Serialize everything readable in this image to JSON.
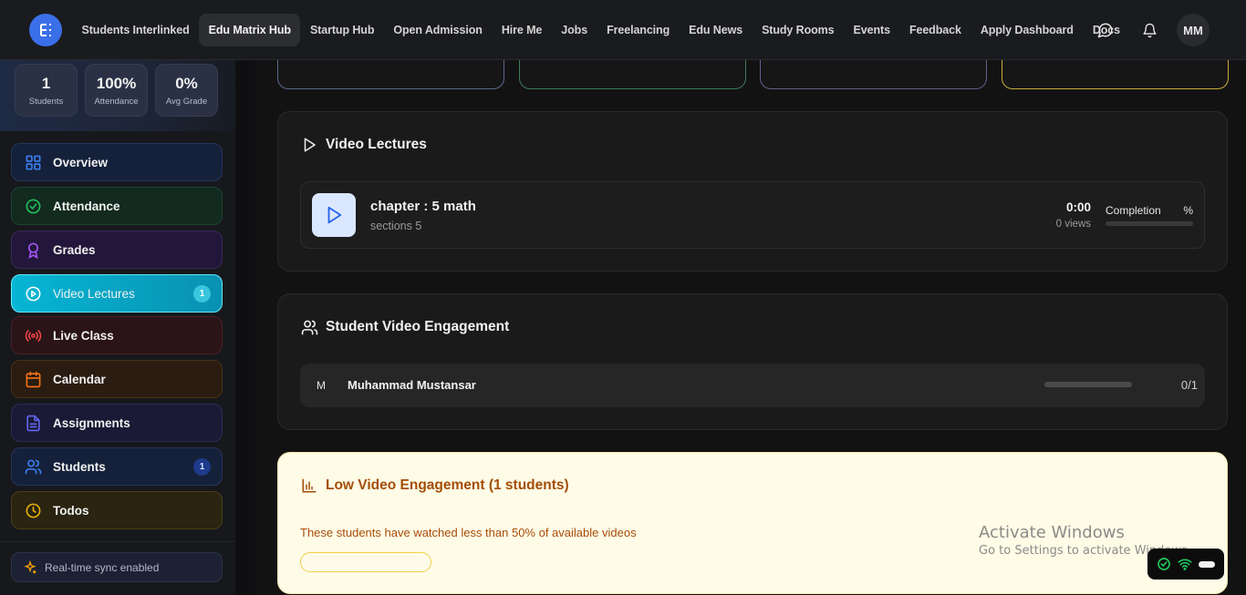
{
  "nav": {
    "items": [
      "Students Interlinked",
      "Edu Matrix Hub",
      "Startup Hub",
      "Open Admission",
      "Hire Me",
      "Jobs",
      "Freelancing",
      "Edu News",
      "Study Rooms",
      "Events",
      "Feedback",
      "Apply Dashboard",
      "Docs"
    ],
    "active_index": 1,
    "avatar_initials": "MM"
  },
  "sidebar": {
    "stats": [
      {
        "value": "1",
        "label": "Students"
      },
      {
        "value": "100%",
        "label": "Attendance"
      },
      {
        "value": "0%",
        "label": "Avg Grade"
      }
    ],
    "items": [
      {
        "label": "Overview",
        "icon": "grid-icon",
        "color": "#3b82f6"
      },
      {
        "label": "Attendance",
        "icon": "check-circle-icon",
        "color": "#22c55e"
      },
      {
        "label": "Grades",
        "icon": "award-icon",
        "color": "#a855f7"
      },
      {
        "label": "Video Lectures",
        "icon": "play-circle-icon",
        "color": "#06b6d4",
        "badge": "1",
        "active": true
      },
      {
        "label": "Live Class",
        "icon": "broadcast-icon",
        "color": "#ef4444"
      },
      {
        "label": "Calendar",
        "icon": "calendar-icon",
        "color": "#f97316"
      },
      {
        "label": "Assignments",
        "icon": "file-text-icon",
        "color": "#6366f1"
      },
      {
        "label": "Students",
        "icon": "users-icon",
        "color": "#3b82f6",
        "badge": "1"
      },
      {
        "label": "Todos",
        "icon": "clock-icon",
        "color": "#eab308"
      }
    ],
    "sync_text": "Real-time sync enabled"
  },
  "video_lectures": {
    "title": "Video Lectures",
    "items": [
      {
        "title": "chapter : 5 math",
        "sections": "sections 5",
        "duration": "0:00",
        "views": "0 views",
        "completion_label": "Completion",
        "completion_pct": "%",
        "completion": 0
      }
    ]
  },
  "engagement": {
    "title": "Student Video Engagement",
    "students": [
      {
        "initial": "M",
        "name": "Muhammad Mustansar",
        "count": "0/1",
        "progress": 0
      }
    ]
  },
  "low_engagement": {
    "title": "Low Video Engagement (1 students)",
    "text": "These students have watched less than 50% of available videos"
  },
  "watermark": {
    "line1": "Activate Windows",
    "line2": "Go to Settings to activate Windows."
  },
  "colors": {
    "accent": "#3b82f6",
    "active_item": "#06b6d4",
    "warning_bg": "#fefbe6",
    "warning_text": "#a34d06"
  }
}
